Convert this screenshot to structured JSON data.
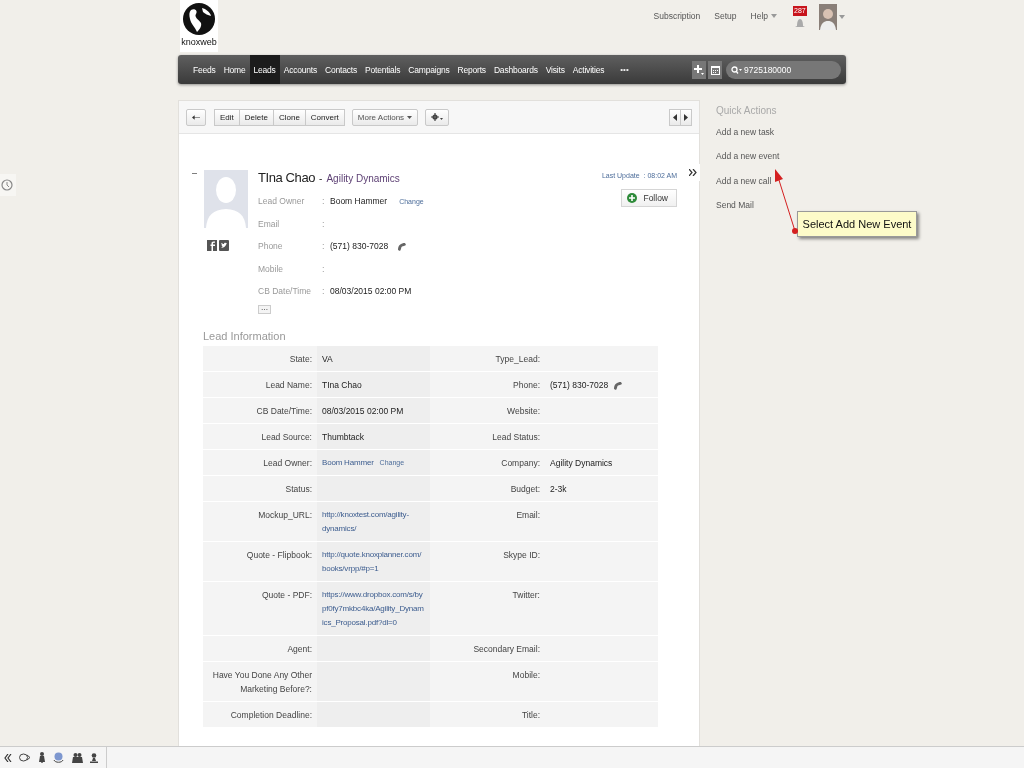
{
  "logo": {
    "text": "knoxweb"
  },
  "top_links": [
    {
      "label": "Subscription",
      "kind": "link"
    },
    {
      "label": "Setup",
      "kind": "link"
    },
    {
      "label": "Help",
      "kind": "menu"
    }
  ],
  "notifications": {
    "count": "287"
  },
  "nav": {
    "items": [
      {
        "label": "Feeds",
        "selected": false
      },
      {
        "label": "Home",
        "selected": false
      },
      {
        "label": "Leads",
        "selected": true
      },
      {
        "label": "Accounts",
        "selected": false
      },
      {
        "label": "Contacts",
        "selected": false
      },
      {
        "label": "Potentials",
        "selected": false
      },
      {
        "label": "Campaigns",
        "selected": false
      },
      {
        "label": "Reports",
        "selected": false
      },
      {
        "label": "Dashboards",
        "selected": false
      },
      {
        "label": "Visits",
        "selected": false
      },
      {
        "label": "Activities",
        "selected": false
      }
    ],
    "more": "•••",
    "search": {
      "value": "9725180000"
    }
  },
  "toolbar": {
    "buttons": [
      "Edit",
      "Delete",
      "Clone",
      "Convert"
    ],
    "more_actions": "More Actions"
  },
  "record": {
    "collapse": "–",
    "name": "TIna Chao",
    "separator": "-",
    "company": "Agility Dynamics",
    "last_update": "Last Update  : 08:02 AM",
    "follow": "Follow",
    "more": "···",
    "fields": [
      {
        "label": "Lead Owner",
        "colon": ":",
        "value": "Boom Hammer",
        "kind": "owner",
        "action": "Change"
      },
      {
        "label": "Email",
        "colon": ":",
        "kind": "text"
      },
      {
        "label": "Phone",
        "colon": ":",
        "value": "(571) 830-7028",
        "kind": "phone"
      },
      {
        "label": "Mobile",
        "colon": ":",
        "kind": "text"
      },
      {
        "label": "CB Date/Time",
        "colon": ":",
        "value": "08/03/2015 02:00 PM",
        "kind": "text"
      }
    ]
  },
  "lead_information": {
    "title": "Lead Information",
    "rows": [
      {
        "left": {
          "label": "State:",
          "value": "VA",
          "kind": "text"
        },
        "right": {
          "label": "Type_Lead:",
          "kind": "text"
        }
      },
      {
        "left": {
          "label": "Lead Name:",
          "value": "TIna Chao",
          "kind": "text"
        },
        "right": {
          "label": "Phone:",
          "value": "(571) 830-7028",
          "kind": "phone"
        }
      },
      {
        "left": {
          "label": "CB Date/Time:",
          "value": "08/03/2015 02:00 PM",
          "kind": "text"
        },
        "right": {
          "label": "Website:",
          "kind": "text"
        }
      },
      {
        "left": {
          "label": "Lead Source:",
          "value": "Thumbtack",
          "kind": "text"
        },
        "right": {
          "label": "Lead Status:",
          "kind": "text"
        }
      },
      {
        "left": {
          "label": "Lead Owner:",
          "value": "Boom Hammer",
          "kind": "owner",
          "action": "Change"
        },
        "right": {
          "label": "Company:",
          "value": "Agility Dynamics",
          "kind": "text"
        }
      },
      {
        "left": {
          "label": "Status:",
          "kind": "text"
        },
        "right": {
          "label": "Budget:",
          "value": "2-3k",
          "kind": "text"
        }
      },
      {
        "left": {
          "label": "Mockup_URL:",
          "value": "http://knoxtest.com/agility-dynamics/",
          "kind": "link"
        },
        "right": {
          "label": "Email:",
          "kind": "text"
        }
      },
      {
        "left": {
          "label": "Quote - Flipbook:",
          "value": "http://quote.knoxplanner.com/books/vrpp/#p=1",
          "kind": "link"
        },
        "right": {
          "label": "Skype ID:",
          "kind": "text"
        }
      },
      {
        "left": {
          "label": "Quote - PDF:",
          "value": "https://www.dropbox.com/s/bypf0fy7mkbc4ka/Agility_Dynamics_Proposal.pdf?dl=0",
          "kind": "link"
        },
        "right": {
          "label": "Twitter:",
          "kind": "text"
        }
      },
      {
        "left": {
          "label": "Agent:",
          "kind": "text"
        },
        "right": {
          "label": "Secondary Email:",
          "kind": "text"
        }
      },
      {
        "left": {
          "label": "Have You Done Any Other Marketing Before?:",
          "kind": "text"
        },
        "right": {
          "label": "Mobile:",
          "kind": "text"
        }
      },
      {
        "left": {
          "label": "Completion Deadline:",
          "kind": "text"
        },
        "right": {
          "label": "Title:",
          "kind": "text"
        }
      }
    ]
  },
  "quick_actions": {
    "title": "Quick Actions",
    "items": [
      "Add a new task",
      "Add a new event",
      "Add a new call",
      "Send Mail"
    ]
  },
  "callout": {
    "text": "Select Add New Event"
  }
}
